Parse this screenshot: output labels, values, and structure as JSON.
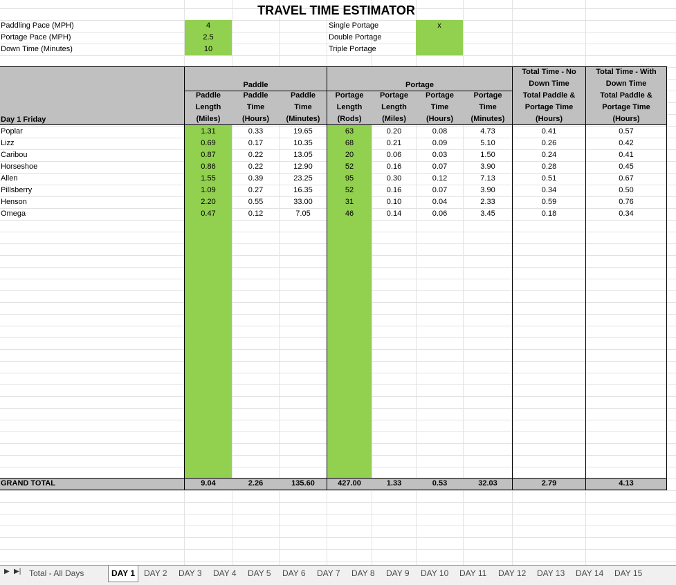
{
  "title": "TRAVEL TIME ESTIMATOR",
  "settings": {
    "paddling_pace_label": "Paddling Pace (MPH)",
    "paddling_pace_value": "4",
    "portage_pace_label": "Portage Pace (MPH)",
    "portage_pace_value": "2.5",
    "down_time_label": "Down Time (Minutes)",
    "down_time_value": "10",
    "single_portage_label": "Single Portage",
    "single_portage_value": "x",
    "double_portage_label": "Double Portage",
    "triple_portage_label": "Triple Portage"
  },
  "headers": {
    "paddle_group": "Paddle",
    "portage_group": "Portage",
    "day_label": "Day 1 Friday",
    "paddle_length": [
      "Paddle",
      "Length",
      "(Miles)"
    ],
    "paddle_hours": [
      "Paddle",
      "Time",
      "(Hours)"
    ],
    "paddle_minutes": [
      "Paddle",
      "Time",
      "(Minutes)"
    ],
    "portage_rods": [
      "Portage",
      "Length",
      "(Rods)"
    ],
    "portage_miles": [
      "Portage",
      "Length",
      "(Miles)"
    ],
    "portage_hours": [
      "Portage",
      "Time",
      "(Hours)"
    ],
    "portage_minutes": [
      "Portage",
      "Time",
      "(Minutes)"
    ],
    "total_no_down": [
      "Total Time - No",
      "Down Time",
      "Total Paddle &",
      "Portage Time",
      "(Hours)"
    ],
    "total_with_down": [
      "Total Time - With",
      "Down Time",
      "Total Paddle &",
      "Portage Time",
      "(Hours)"
    ]
  },
  "rows": [
    {
      "lake": "Poplar",
      "pl": "1.31",
      "ph": "0.33",
      "pm": "19.65",
      "rods": "63",
      "pmi": "0.20",
      "pth": "0.08",
      "ptm": "4.73",
      "tn": "0.41",
      "tw": "0.57"
    },
    {
      "lake": "Lizz",
      "pl": "0.69",
      "ph": "0.17",
      "pm": "10.35",
      "rods": "68",
      "pmi": "0.21",
      "pth": "0.09",
      "ptm": "5.10",
      "tn": "0.26",
      "tw": "0.42"
    },
    {
      "lake": "Caribou",
      "pl": "0.87",
      "ph": "0.22",
      "pm": "13.05",
      "rods": "20",
      "pmi": "0.06",
      "pth": "0.03",
      "ptm": "1.50",
      "tn": "0.24",
      "tw": "0.41"
    },
    {
      "lake": "Horseshoe",
      "pl": "0.86",
      "ph": "0.22",
      "pm": "12.90",
      "rods": "52",
      "pmi": "0.16",
      "pth": "0.07",
      "ptm": "3.90",
      "tn": "0.28",
      "tw": "0.45"
    },
    {
      "lake": "Allen",
      "pl": "1.55",
      "ph": "0.39",
      "pm": "23.25",
      "rods": "95",
      "pmi": "0.30",
      "pth": "0.12",
      "ptm": "7.13",
      "tn": "0.51",
      "tw": "0.67"
    },
    {
      "lake": "Pillsberry",
      "pl": "1.09",
      "ph": "0.27",
      "pm": "16.35",
      "rods": "52",
      "pmi": "0.16",
      "pth": "0.07",
      "ptm": "3.90",
      "tn": "0.34",
      "tw": "0.50"
    },
    {
      "lake": "Henson",
      "pl": "2.20",
      "ph": "0.55",
      "pm": "33.00",
      "rods": "31",
      "pmi": "0.10",
      "pth": "0.04",
      "ptm": "2.33",
      "tn": "0.59",
      "tw": "0.76"
    },
    {
      "lake": "Omega",
      "pl": "0.47",
      "ph": "0.12",
      "pm": "7.05",
      "rods": "46",
      "pmi": "0.14",
      "pth": "0.06",
      "ptm": "3.45",
      "tn": "0.18",
      "tw": "0.34"
    }
  ],
  "grand_total": {
    "label": "GRAND TOTAL",
    "pl": "9.04",
    "ph": "2.26",
    "pm": "135.60",
    "rods": "427.00",
    "pmi": "1.33",
    "pth": "0.53",
    "ptm": "32.03",
    "tn": "2.79",
    "tw": "4.13"
  },
  "sheet_tabs": [
    "Total - All Days",
    "DAY 1",
    "DAY 2",
    "DAY 3",
    "DAY 4",
    "DAY 5",
    "DAY 6",
    "DAY 7",
    "DAY 8",
    "DAY 9",
    "DAY 10",
    "DAY 11",
    "DAY 12",
    "DAY 13",
    "DAY 14",
    "DAY 15"
  ],
  "active_tab": "DAY 1",
  "colors": {
    "input_green": "#92d050",
    "header_gray": "#c0c0c0"
  },
  "icons": {
    "nav_next": "triangle-right-icon",
    "nav_last": "triangle-last-icon"
  }
}
